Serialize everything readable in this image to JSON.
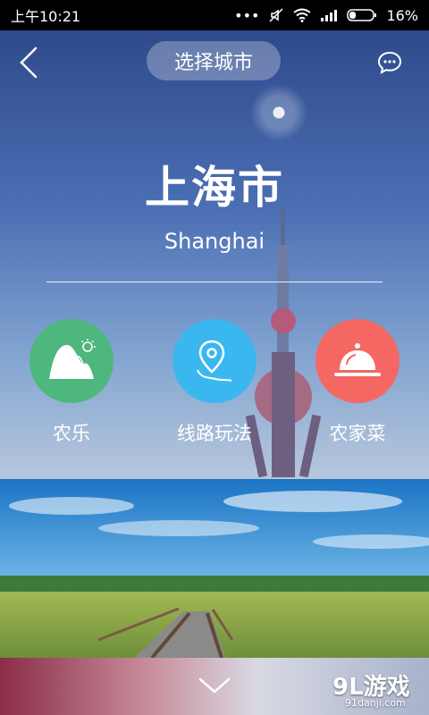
{
  "status_bar": {
    "time": "上午10:21",
    "battery": "16%"
  },
  "header": {
    "city_select_label": "选择城市"
  },
  "city": {
    "name": "上海市",
    "name_en": "Shanghai"
  },
  "categories": [
    {
      "label": "农乐",
      "color": "#4db77e",
      "icon": "mountain-sun-icon"
    },
    {
      "label": "线路玩法",
      "color": "#3ab7ef",
      "icon": "route-pin-icon"
    },
    {
      "label": "农家菜",
      "color": "#f46763",
      "icon": "food-cloche-icon"
    }
  ],
  "watermark": {
    "brand": "9L游戏",
    "url": "91danji.com"
  }
}
